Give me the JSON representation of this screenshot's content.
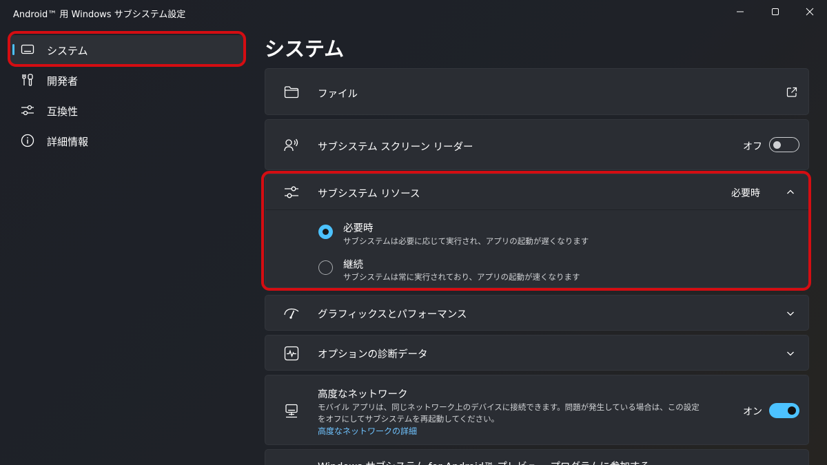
{
  "window": {
    "title": "Android™ 用 Windows サブシステム設定",
    "controls": [
      "minimize-icon",
      "maximize-icon",
      "close-icon"
    ]
  },
  "sidebar": {
    "items": [
      {
        "label": "システム",
        "icon": "monitor-icon",
        "selected": true
      },
      {
        "label": "開発者",
        "icon": "tools-icon",
        "selected": false
      },
      {
        "label": "互換性",
        "icon": "sliders-icon",
        "selected": false
      },
      {
        "label": "詳細情報",
        "icon": "info-icon",
        "selected": false
      }
    ]
  },
  "main": {
    "page_title": "システム",
    "files": {
      "label": "ファイル",
      "icon": "folder-icon",
      "action_icon": "open-external-icon"
    },
    "screen_reader": {
      "label": "サブシステム スクリーン リーダー",
      "icon": "screen-reader-icon",
      "state": "オフ",
      "toggled": false
    },
    "resources": {
      "label": "サブシステム リソース",
      "icon": "sliders-icon",
      "value": "必要時",
      "expanded": true,
      "options": [
        {
          "label": "必要時",
          "description": "サブシステムは必要に応じて実行され、アプリの起動が遅くなります",
          "checked": true
        },
        {
          "label": "継続",
          "description": "サブシステムは常に実行されており、アプリの起動が速くなります",
          "checked": false
        }
      ]
    },
    "graphics": {
      "label": "グラフィックスとパフォーマンス",
      "icon": "gauge-icon"
    },
    "diagnostics": {
      "label": "オプションの診断データ",
      "icon": "activity-icon"
    },
    "network": {
      "label": "高度なネットワーク",
      "icon": "network-icon",
      "description": "モバイル アプリは、同じネットワーク上のデバイスに接続できます。問題が発生している場合は、この設定をオフにしてサブシステムを再起動してください。",
      "link": "高度なネットワークの詳細",
      "state": "オン",
      "toggled": true
    },
    "preview": {
      "label": "Windows サブシステム for Android™ プレビュー プログラムに参加する"
    }
  },
  "colors": {
    "accent": "#4cc2ff",
    "highlight": "#d40d12"
  }
}
